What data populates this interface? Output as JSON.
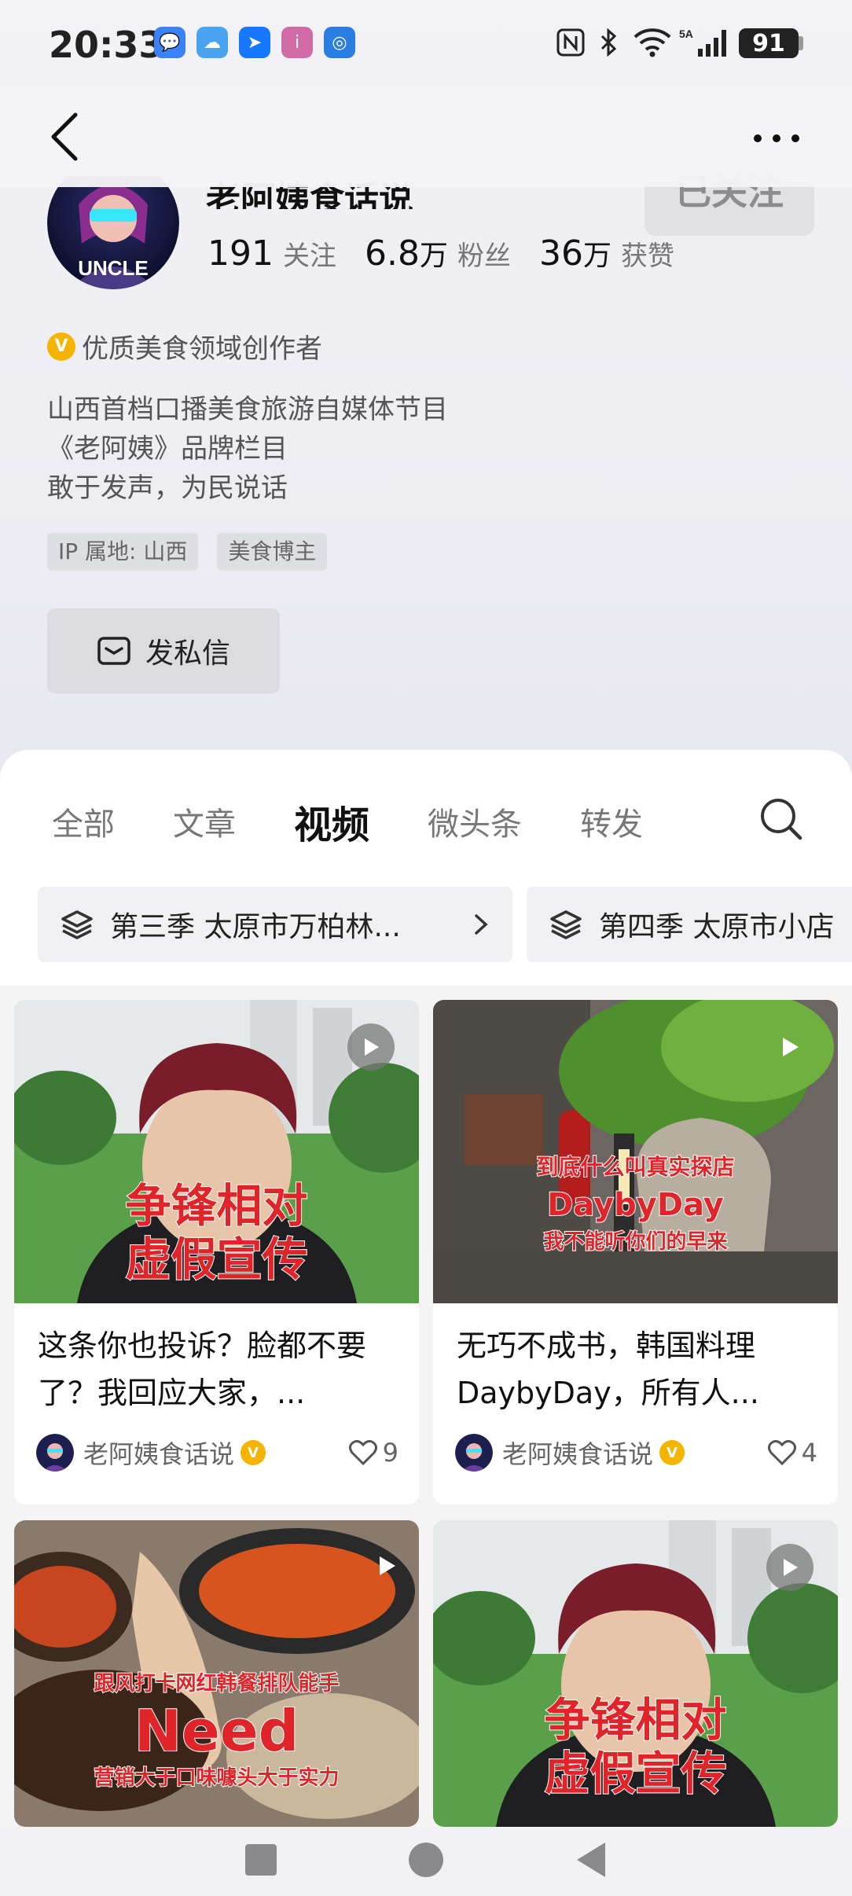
{
  "status_bar": {
    "time": "20:33",
    "battery": "91",
    "network": "5A"
  },
  "profile": {
    "name": "老阿姨食话说",
    "follow_button": "已关注",
    "stats": [
      {
        "num": "191",
        "unit": "",
        "label": "关注"
      },
      {
        "num": "6.8",
        "unit": "万",
        "label": "粉丝"
      },
      {
        "num": "36",
        "unit": "万",
        "label": "获赞"
      }
    ],
    "certification": "优质美食领域创作者",
    "cert_badge": "V",
    "bio": [
      "山西首档口播美食旅游自媒体节目",
      "《老阿姨》品牌栏目",
      "敢于发声，为民说话"
    ],
    "tags": [
      "IP 属地: 山西",
      "美食博主"
    ],
    "dm_button": "发私信",
    "avatar_text": "UNCLE"
  },
  "tabs": [
    {
      "label": "全部",
      "active": false
    },
    {
      "label": "文章",
      "active": false
    },
    {
      "label": "视频",
      "active": true
    },
    {
      "label": "微头条",
      "active": false
    },
    {
      "label": "转发",
      "active": false
    }
  ],
  "collections": [
    "第三季 太原市万柏林...",
    "第四季 太原市小店"
  ],
  "cards": [
    {
      "title": "这条你也投诉？脸都不要了？我回应大家，...",
      "author": "老阿姨食话说",
      "likes": "9",
      "overlay": [
        "争锋相对",
        "虚假宣传"
      ]
    },
    {
      "title": "无巧不成书，韩国料理DaybyDay，所有人...",
      "author": "老阿姨食话说",
      "likes": "4",
      "overlay": [
        "到底什么叫真实探店",
        "DaybyDay",
        "我不能听你们的早来"
      ]
    },
    {
      "title": "",
      "author": "",
      "likes": "",
      "overlay": [
        "跟风打卡网红韩餐排队能手",
        "Need",
        "营销大于口味噱头大于实力"
      ]
    },
    {
      "title": "",
      "author": "",
      "likes": "",
      "overlay": [
        "争锋相对",
        "虚假宣传"
      ]
    }
  ],
  "colors": {
    "accent_red": "#e0252a",
    "badge_gold": "#f4b400"
  }
}
